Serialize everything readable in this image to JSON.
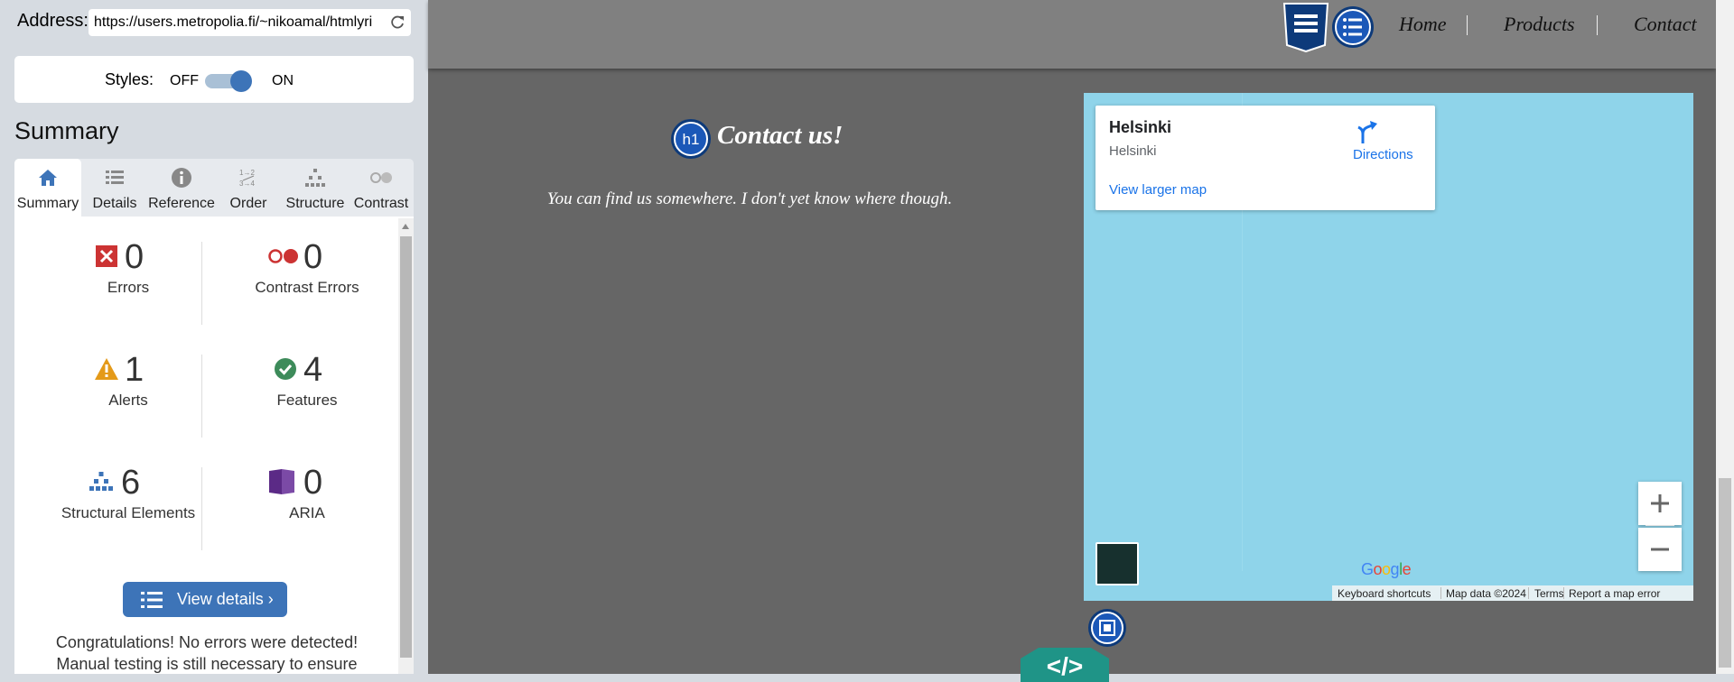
{
  "panel": {
    "address_label": "Address:",
    "address_value": "https://users.metropolia.fi/~nikoamal/htmlyri",
    "styles_label": "Styles:",
    "styles_off": "OFF",
    "styles_on": "ON",
    "summary_title": "Summary",
    "tabs": [
      {
        "label": "Summary",
        "icon": "home-icon"
      },
      {
        "label": "Details",
        "icon": "list-icon"
      },
      {
        "label": "Reference",
        "icon": "info-icon"
      },
      {
        "label": "Order",
        "icon": "order-icon"
      },
      {
        "label": "Structure",
        "icon": "structure-icon"
      },
      {
        "label": "Contrast",
        "icon": "contrast-icon"
      }
    ],
    "stats": {
      "errors": {
        "value": "0",
        "label": "Errors",
        "color": "#cc3333"
      },
      "contrast_errors": {
        "value": "0",
        "label": "Contrast Errors",
        "color": "#cc3333"
      },
      "alerts": {
        "value": "1",
        "label": "Alerts",
        "color": "#e49a19"
      },
      "features": {
        "value": "4",
        "label": "Features",
        "color": "#3d8b5a"
      },
      "structural": {
        "value": "6",
        "label": "Structural Elements",
        "color": "#3d74b8"
      },
      "aria": {
        "value": "0",
        "label": "ARIA",
        "color": "#5b2a86"
      }
    },
    "view_details": "View details ›",
    "congrats_line1": "Congratulations! No errors were detected!",
    "congrats_line2": "Manual testing is still necessary to ensure"
  },
  "page": {
    "nav": [
      "Home",
      "Products",
      "Contact"
    ],
    "h1_badge": "h1",
    "contact_title": "Contact us!",
    "contact_text": "You can find us somewhere. I don't yet know where though.",
    "code_badge": "</>"
  },
  "map": {
    "place_title": "Helsinki",
    "place_subtitle": "Helsinki",
    "directions": "Directions",
    "view_larger": "View larger map",
    "zoom_in": "+",
    "zoom_out": "−",
    "logo": "Google",
    "attribution": [
      "Keyboard shortcuts",
      "Map data ©2024",
      "Terms",
      "Report a map error"
    ]
  },
  "colors": {
    "accent": "#3d74b8",
    "page_bg": "#666666",
    "header_bg": "#808080",
    "map_water": "#8fd4ea",
    "teal": "#1f9487"
  }
}
